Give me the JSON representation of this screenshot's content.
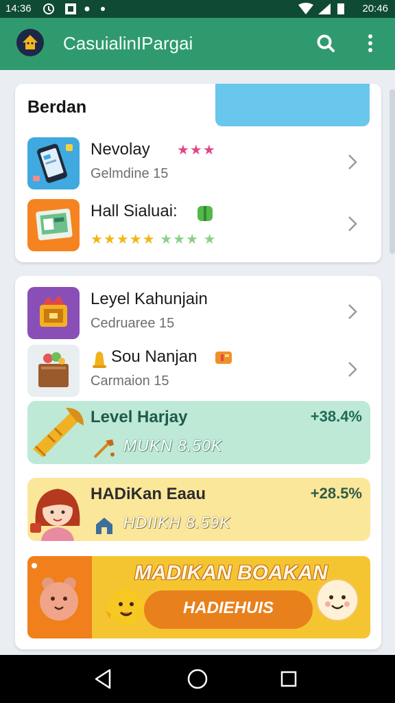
{
  "status_bar": {
    "time": "14:36",
    "clock": "20:46"
  },
  "app_bar": {
    "title": "CasuialinIPargai"
  },
  "card1": {
    "title": "Berdan",
    "items": [
      {
        "title": "Nevolay",
        "subtitle": "Gelmdine 15",
        "rating_pink": "★★★"
      },
      {
        "title": "Hall Sialuai:",
        "rating_gold": "★★★★★",
        "rating_green": "★★★ ★"
      }
    ]
  },
  "card2": {
    "items": [
      {
        "title": "Leyel Kahunjain",
        "subtitle": "Cedruaree 15"
      },
      {
        "title": "Sou Nanjan",
        "subtitle": "Carmaion 15"
      }
    ],
    "promos": [
      {
        "title": "Level Harjay",
        "value": "+38.4%",
        "subtitle": "MUKN 8.50K"
      },
      {
        "title": "HADiKan Eaau",
        "value": "+28.5%",
        "subtitle": "HDIIKH 8.59K"
      }
    ],
    "banner": {
      "title": "MADIKAN BOAKAN",
      "button": "HADIEHUIS"
    }
  }
}
